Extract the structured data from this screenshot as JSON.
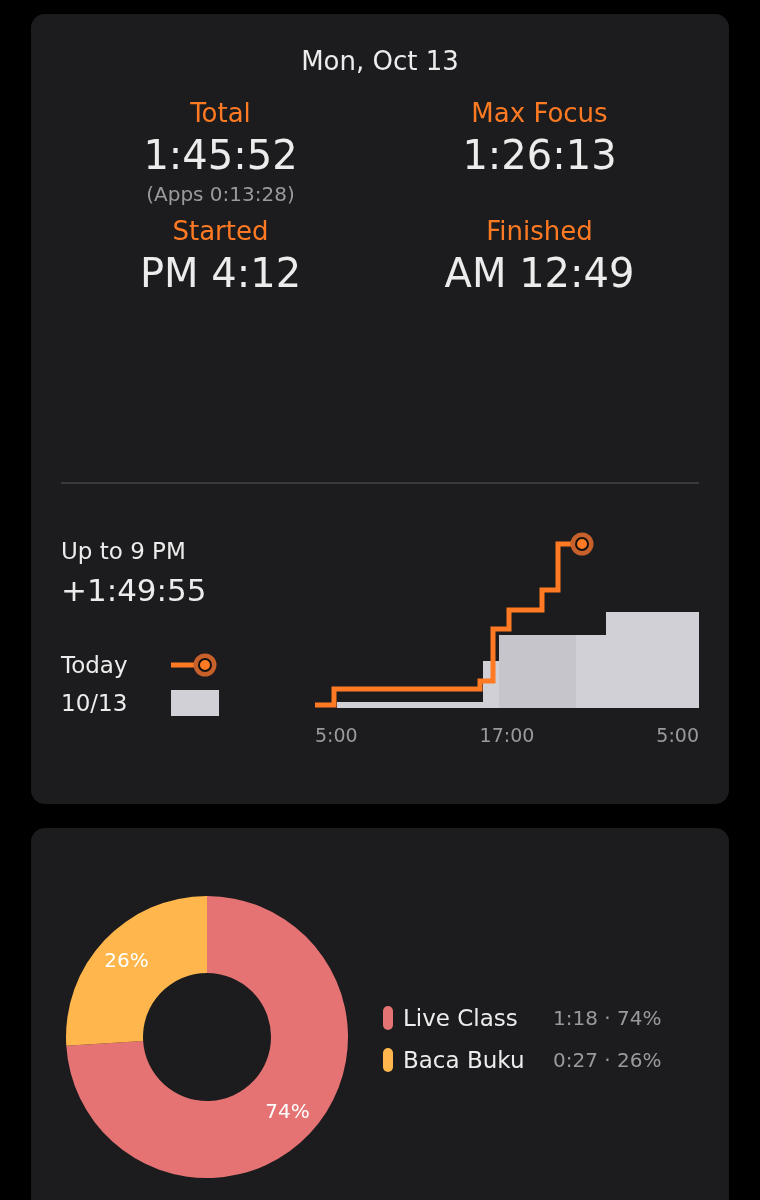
{
  "summary": {
    "date": "Mon, Oct 13",
    "stats": [
      {
        "label": "Total",
        "value": "1:45:52",
        "note": "(Apps 0:13:28)"
      },
      {
        "label": "Max Focus",
        "value": "1:26:13"
      },
      {
        "label": "Started",
        "value": "PM 4:12"
      },
      {
        "label": "Finished",
        "value": "AM 12:49"
      }
    ],
    "progress": {
      "caption": "Up to 9 PM",
      "delta": "+1:49:55",
      "legend": [
        {
          "kind": "line",
          "label": "Today"
        },
        {
          "kind": "bar",
          "label": "10/13"
        }
      ],
      "x_ticks": [
        "5:00",
        "17:00",
        "5:00"
      ]
    }
  },
  "breakdown": {
    "chart_data": {
      "type": "donut",
      "categories": [
        "Live Class",
        "Baca Buku"
      ],
      "values": [
        74,
        26
      ],
      "data_labels": true,
      "value_labels": [
        "74%",
        "26%"
      ],
      "colors": [
        "#e57373",
        "#ffb74d"
      ]
    },
    "legend": [
      {
        "detail": "1:18 · 74%",
        "color": "#e57373"
      },
      {
        "detail": "0:27 · 26%",
        "color": "#ffb74d"
      }
    ]
  }
}
